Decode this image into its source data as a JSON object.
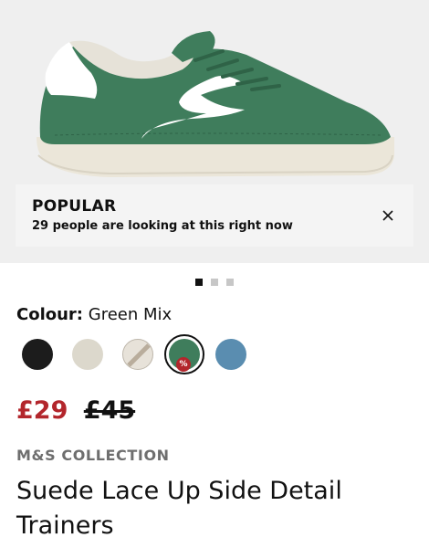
{
  "hero": {
    "image_alt": "Green suede trainer with white side detail",
    "colors": {
      "suede": "#3f7d5c",
      "sole": "#ebe6d9",
      "accent": "#ffffff",
      "background": "#efefef"
    }
  },
  "popular": {
    "title": "POPULAR",
    "message": "29 people are looking at this right now",
    "close_icon": "close-icon"
  },
  "carousel": {
    "total": 3,
    "active": 1
  },
  "colour": {
    "label": "Colour:",
    "value": "Green Mix",
    "swatches": [
      {
        "name": "Black",
        "color": "#1c1c1c"
      },
      {
        "name": "Cream",
        "color": "#dcd8cc"
      },
      {
        "name": "Beige/White",
        "color": "#d8cfc4"
      },
      {
        "name": "Green Mix",
        "color": "#3f7d5c",
        "selected": true,
        "sale_badge": "%"
      },
      {
        "name": "Blue",
        "color": "#5a8db0"
      }
    ]
  },
  "price": {
    "now": "£29",
    "was": "£45",
    "sale_color": "#b3262c"
  },
  "product": {
    "brand": "M&S COLLECTION",
    "title": "Suede Lace Up Side Detail Trainers"
  }
}
